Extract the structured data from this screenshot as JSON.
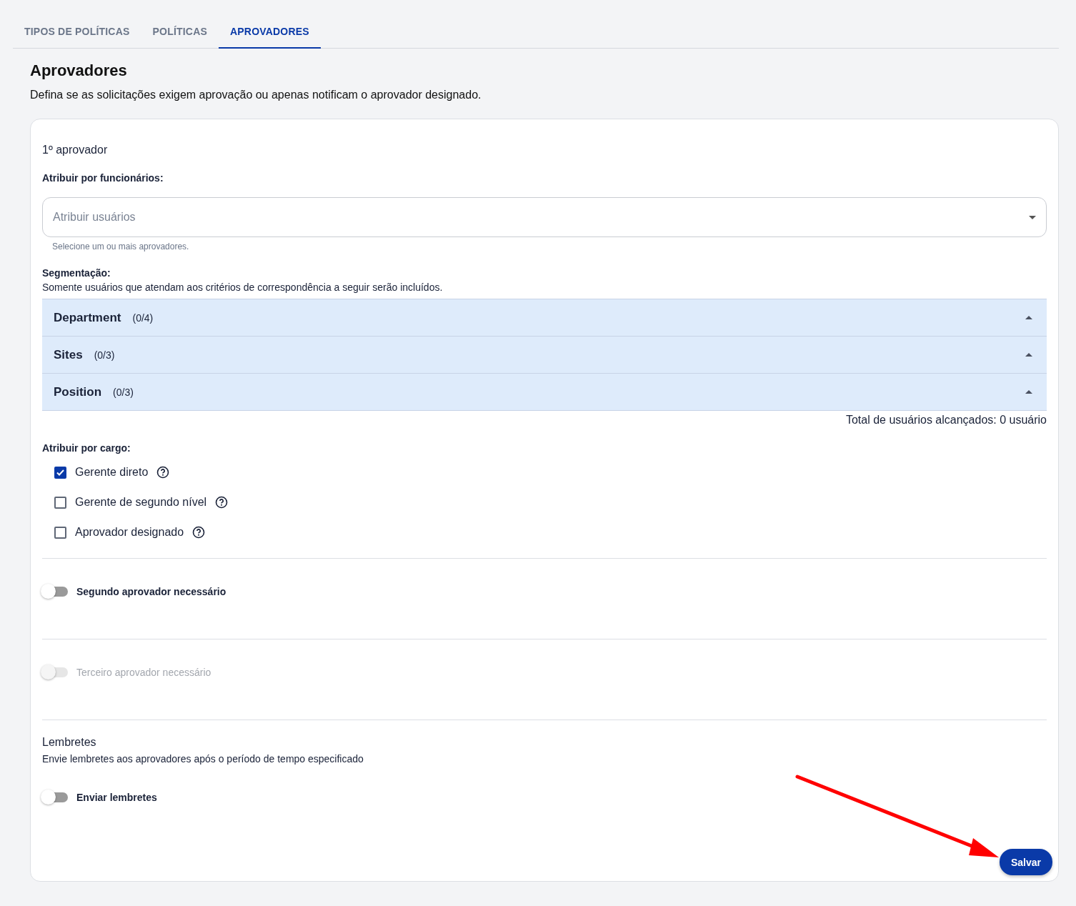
{
  "tabs": [
    {
      "label": "TIPOS DE POLÍTICAS",
      "selected": false
    },
    {
      "label": "POLÍTICAS",
      "selected": false
    },
    {
      "label": "APROVADORES",
      "selected": true
    }
  ],
  "page": {
    "title": "Aprovadores",
    "description": "Defina se as solicitações exigem aprovação ou apenas notificam o aprovador designado."
  },
  "approver": {
    "heading": "1º aprovador",
    "employees_label": "Atribuir por funcionários:",
    "select": {
      "placeholder": "Atribuir usuários"
    },
    "helper": "Selecione um ou mais aprovadores.",
    "segmentation_label": "Segmentação:",
    "segmentation_text": "Somente usuários que atendam aos critérios de correspondência a seguir serão incluídos.",
    "segments": [
      {
        "name": "Department",
        "count": "(0/4)"
      },
      {
        "name": "Sites",
        "count": "(0/3)"
      },
      {
        "name": "Position",
        "count": "(0/3)"
      }
    ],
    "total": "Total de usuários alcançados: 0 usuário",
    "role_label": "Atribuir por cargo:",
    "roles": [
      {
        "label": "Gerente direto",
        "checked": true
      },
      {
        "label": "Gerente de segundo nível",
        "checked": false
      },
      {
        "label": "Aprovador designado",
        "checked": false
      }
    ]
  },
  "toggles": [
    {
      "label": "Segundo aprovador necessário",
      "on": false,
      "disabled": false
    },
    {
      "label": "Terceiro aprovador necessário",
      "on": false,
      "disabled": true
    }
  ],
  "reminders": {
    "title": "Lembretes",
    "description": "Envie lembretes aos aprovadores após o período de tempo especificado",
    "toggle": {
      "label": "Enviar lembretes",
      "on": false,
      "disabled": false
    }
  },
  "save_button": "Salvar"
}
